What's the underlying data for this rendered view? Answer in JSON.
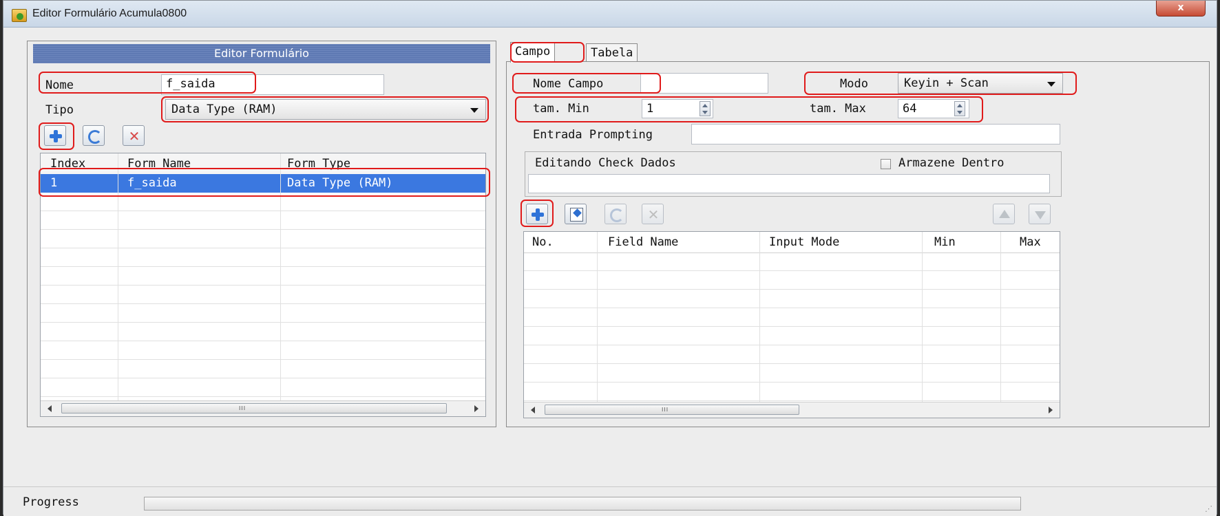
{
  "window": {
    "title": "Editor Formulário  Acumula0800",
    "close_label": "x"
  },
  "left": {
    "header": "Editor Formulário",
    "nome_label": "Nome",
    "nome_value": "f_saida",
    "tipo_label": "Tipo",
    "tipo_value": "Data Type (RAM)",
    "table": {
      "columns": [
        "Index",
        "Form Name",
        "Form Type"
      ],
      "rows": [
        [
          "1",
          "f_saida",
          "Data Type (RAM)"
        ]
      ]
    }
  },
  "right": {
    "tabs": [
      "Campo",
      "Tabela"
    ],
    "active_tab": "Campo",
    "nome_campo_label": "Nome Campo",
    "nome_campo_value": "",
    "modo_label": "Modo",
    "modo_value": "Keyin + Scan",
    "tam_min_label": "tam. Min",
    "tam_min_value": "1",
    "tam_max_label": "tam. Max",
    "tam_max_value": "64",
    "entrada_label": "Entrada Prompting",
    "entrada_value": "",
    "check_group_label": "Editando Check Dados",
    "armazene_label": "Armazene Dentro",
    "check_value": "",
    "table": {
      "columns": [
        "No.",
        "Field Name",
        "Input Mode",
        "Min",
        "Max"
      ]
    }
  },
  "status": {
    "progress_label": "Progress",
    "progress": 0
  },
  "icons": {
    "add": "plus-icon",
    "refresh": "refresh-icon",
    "delete": "delete-icon",
    "edit": "edit-icon",
    "up": "up-arrow-icon",
    "down": "down-arrow-icon"
  },
  "colors": {
    "selection": "#3b78e0",
    "header_bar": "#5e79b3",
    "highlight_box": "#e01a1a"
  }
}
